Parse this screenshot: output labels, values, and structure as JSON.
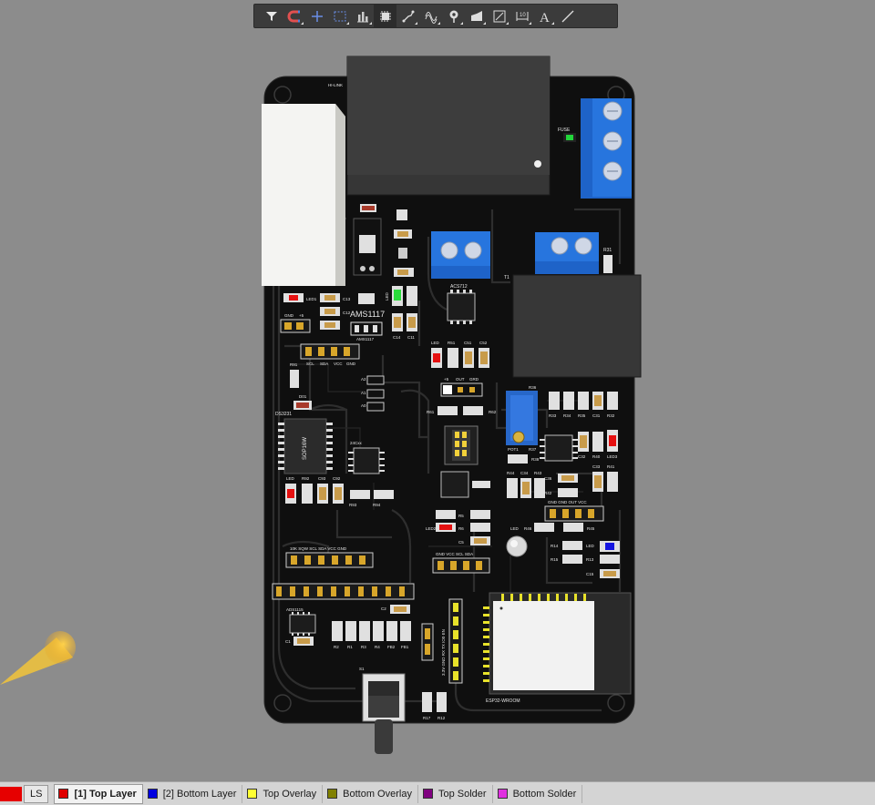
{
  "toolbar": {
    "tools": [
      {
        "icon": "filter-icon",
        "name": "filter"
      },
      {
        "icon": "magnet-icon",
        "name": "interactive-routing"
      },
      {
        "icon": "crosshair-icon",
        "name": "add-point"
      },
      {
        "icon": "select-rect-icon",
        "name": "select-rectangle"
      },
      {
        "icon": "align-icon",
        "name": "align"
      },
      {
        "icon": "component-icon",
        "name": "place-component"
      },
      {
        "icon": "route-icon",
        "name": "route"
      },
      {
        "icon": "diff-pair-icon",
        "name": "differential-pair"
      },
      {
        "icon": "via-icon",
        "name": "place-via"
      },
      {
        "icon": "polygon-icon",
        "name": "polygon-pour"
      },
      {
        "icon": "region-icon",
        "name": "region"
      },
      {
        "icon": "dimension-icon",
        "name": "dimension"
      },
      {
        "icon": "text-icon",
        "name": "string"
      },
      {
        "icon": "line-icon",
        "name": "line"
      }
    ]
  },
  "board": {
    "labels": {
      "hilink": "HI-LINK",
      "fuse": "FUSE",
      "t1": "T1",
      "r31": "R31",
      "acs712": "ACS712",
      "ams1117_big": "AMS1117",
      "ams1117_small": "AMS1117",
      "led1": "LED1",
      "c13": "C13",
      "c12": "C12",
      "led": "LED",
      "c14": "C14",
      "c11": "C11",
      "r51": "R51",
      "c51": "C51",
      "c52": "C52",
      "gnd": "GND",
      "plus5": "+5",
      "scl": "SCL",
      "sda": "SDA",
      "vcc": "VCC",
      "gnd2": "GND",
      "r91": "R91",
      "a2": "A2",
      "a1": "A1",
      "a0": "A0",
      "d01": "D01",
      "ds3231": "DS3231",
      "sop16w": "SOP16W",
      "at24cxx": "24Cxx",
      "out_plus5": "+5",
      "out": "OUT",
      "grd": "GRD",
      "r61": "R61",
      "r62": "R62",
      "r36": "R36",
      "r33": "R33",
      "r34": "R34",
      "r35": "R35",
      "c31": "C31",
      "r32": "R32",
      "pot1": "POT1",
      "r37": "R37",
      "c32": "C32",
      "r40": "R40",
      "led3": "LED3",
      "r38": "R38",
      "c33": "C33",
      "r41": "R41",
      "r44": "R44",
      "c34": "C34",
      "r43": "R43",
      "c36": "C36",
      "r42": "R42",
      "led_b": "LED",
      "r92": "R92",
      "c93": "C93",
      "c92": "C92",
      "r93": "R93",
      "r94": "R94",
      "gnd_gnd_out_vcc": "GND  GND  OUT  VCC",
      "r5": "R5",
      "r6": "R6",
      "led2": "LED2",
      "c5": "C5",
      "led_c": "LED",
      "r46": "R46",
      "r45": "R45",
      "r14": "R14",
      "r15": "R15",
      "r13": "R13",
      "led_d": "LED",
      "c15": "C15",
      "header1": "10K  SQW  SCL  SDA  VCC  GND",
      "header2": "GND  VCC  SCL  SDA",
      "ads1115": "ADS1115",
      "c1": "C1",
      "c2": "C2",
      "r2": "R2",
      "r1": "R1",
      "r3": "R3",
      "r4": "R4",
      "fb2": "FB2",
      "fb1": "FB1",
      "s1": "S1",
      "r17": "R17",
      "r12": "R12",
      "esp": "ESP32-WROOM",
      "esp_pins": "3.3V  GND  RX  TX  IO0  EN"
    }
  },
  "statusbar": {
    "ls_label": "LS",
    "layers": [
      {
        "label": "[1] Top Layer",
        "color": "#e00000",
        "active": true
      },
      {
        "label": "[2] Bottom Layer",
        "color": "#0000e0",
        "active": false
      },
      {
        "label": "Top Overlay",
        "color": "#ffff33",
        "active": false
      },
      {
        "label": "Bottom Overlay",
        "color": "#808000",
        "active": false
      },
      {
        "label": "Top Solder",
        "color": "#800080",
        "active": false
      },
      {
        "label": "Bottom Solder",
        "color": "#e030e0",
        "active": false
      }
    ]
  }
}
